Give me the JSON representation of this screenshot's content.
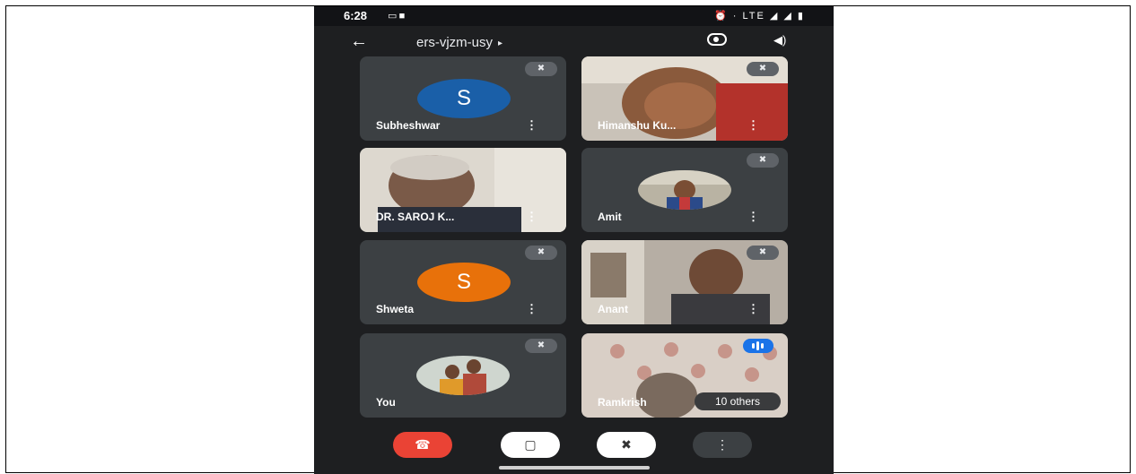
{
  "status_bar": {
    "time": "6:28",
    "left_icons": "▭ ■",
    "right_icons": "⏰ · LTE ◢ ◢ ▮"
  },
  "meeting": {
    "code": "ers-vjzm-usy",
    "caret": "▸",
    "back_icon": "←",
    "speaker_icon": "◀)"
  },
  "tiles": [
    {
      "name": "Subheshwar",
      "avatar_letter": "S",
      "avatar_color": "#1a5fa8",
      "muted": true
    },
    {
      "name": "Himanshu Ku...",
      "muted": true
    },
    {
      "name": "DR. SAROJ K...",
      "muted": false
    },
    {
      "name": "Amit",
      "muted": true
    },
    {
      "name": "Shweta",
      "avatar_letter": "S",
      "avatar_color": "#e8710a",
      "muted": true
    },
    {
      "name": "Anant",
      "muted": true
    },
    {
      "name": "You",
      "muted": true
    },
    {
      "name": "Ramkrish",
      "others_label": "10 others"
    }
  ],
  "icons": {
    "mute": "✖",
    "more": "⋮",
    "end_call": "☎",
    "camera_off": "▢",
    "mic_off": "✖",
    "more_options": "⋮"
  },
  "colors": {
    "end_call": "#ea4335",
    "control_bg": "#ffffff",
    "more_bg": "#3c4043",
    "tile_bg": "#3c4043"
  }
}
